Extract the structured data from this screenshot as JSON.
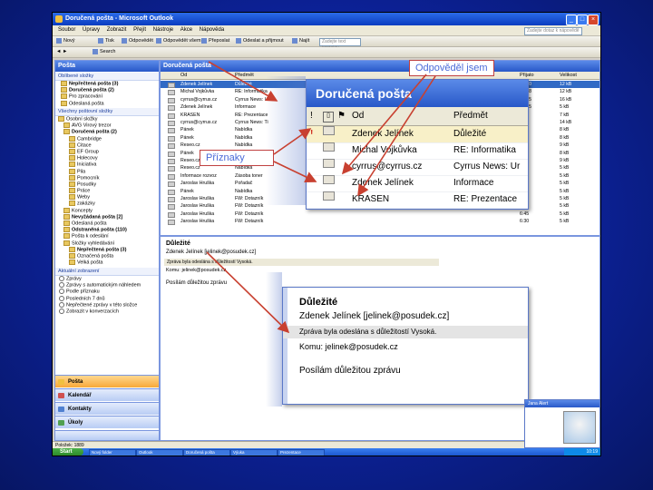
{
  "window": {
    "title": "Doručená pošta - Microsoft Outlook"
  },
  "menu": [
    "Soubor",
    "Úpravy",
    "Zobrazit",
    "Přejít",
    "Nástroje",
    "Akce",
    "Nápověda"
  ],
  "help_box": "Zadejte dotaz k nápovědě",
  "toolbar1": {
    "new": "Nový",
    "print": "Tisk",
    "reply": "Odpovědět",
    "reply_all": "Odpovědět všem",
    "forward": "Přeposlat",
    "send_receive": "Odeslat a přijmout",
    "find": "Najít",
    "search_placeholder": "Zadejte text kontaktu"
  },
  "toolbar2": {
    "search": "Search"
  },
  "nav": {
    "header": "Pošta",
    "favorites_title": "Oblíbené složky",
    "favorites": [
      {
        "label": "Nepřečtená pošta (3)",
        "bold": true
      },
      {
        "label": "Doručená pošta (2)",
        "bold": true
      },
      {
        "label": "Pro zpracování",
        "bold": false
      },
      {
        "label": "Odeslaná pošta",
        "bold": false
      }
    ],
    "allmail_title": "Všechny poštovní složky",
    "folders": [
      {
        "label": "Osobní složky",
        "indent": 0,
        "bold": false
      },
      {
        "label": "AVG Virový trezor",
        "indent": 1,
        "bold": false
      },
      {
        "label": "Doručená pošta (2)",
        "indent": 1,
        "bold": true
      },
      {
        "label": "Cambridge",
        "indent": 2,
        "bold": false
      },
      {
        "label": "Citace",
        "indent": 2,
        "bold": false
      },
      {
        "label": "EF Group",
        "indent": 2,
        "bold": false
      },
      {
        "label": "Holecovy",
        "indent": 2,
        "bold": false
      },
      {
        "label": "Iniciativa",
        "indent": 2,
        "bold": false
      },
      {
        "label": "Pila",
        "indent": 2,
        "bold": false
      },
      {
        "label": "Pomocník",
        "indent": 2,
        "bold": false
      },
      {
        "label": "Posudky",
        "indent": 2,
        "bold": false
      },
      {
        "label": "Práce",
        "indent": 2,
        "bold": false
      },
      {
        "label": "Weby",
        "indent": 2,
        "bold": false
      },
      {
        "label": "zakázky",
        "indent": 2,
        "bold": false
      },
      {
        "label": "Koncepty",
        "indent": 1,
        "bold": false
      },
      {
        "label": "Nevyžádaná pošta [2]",
        "indent": 1,
        "bold": true
      },
      {
        "label": "Odeslaná pošta",
        "indent": 1,
        "bold": false
      },
      {
        "label": "Odstraněná pošta (110)",
        "indent": 1,
        "bold": true
      },
      {
        "label": "Pošta k odeslání",
        "indent": 1,
        "bold": false
      },
      {
        "label": "Složky vyhledávání",
        "indent": 1,
        "bold": false
      },
      {
        "label": "Nepřečtená pošta (3)",
        "indent": 2,
        "bold": true
      },
      {
        "label": "Označená pošta",
        "indent": 2,
        "bold": false
      },
      {
        "label": "Velká pošta",
        "indent": 2,
        "bold": false
      }
    ],
    "current_view_title": "Aktuální zobrazení",
    "views": [
      "Zprávy",
      "Zprávy s automatickým náhledem",
      "Podle příznaku",
      "Posledních 7 dnů",
      "Nepřečtené zprávy v této složce",
      "Zobrazit v konverzacích"
    ],
    "buttons": [
      {
        "label": "Pošta",
        "active": true,
        "color": "#f0c040"
      },
      {
        "label": "Kalendář",
        "active": false,
        "color": "#d05050"
      },
      {
        "label": "Kontakty",
        "active": false,
        "color": "#5080d0"
      },
      {
        "label": "Úkoly",
        "active": false,
        "color": "#50a050"
      }
    ]
  },
  "list": {
    "header": "Doručená pošta",
    "columns": {
      "from": "Od",
      "subject": "Předmět",
      "received": "Přijato",
      "size": "Velikost"
    },
    "rows": [
      {
        "from": "Zdenek Jelínek",
        "subject": "Důležité",
        "received": "10:20",
        "size": "12 kB",
        "selected": true
      },
      {
        "from": "Michal Vojkůvka",
        "subject": "RE: Informatika",
        "received": "10:18",
        "size": "12 kB",
        "selected": false
      },
      {
        "from": "cyrrus@cyrrus.cz",
        "subject": "Cyrrus News: Um",
        "received": "10:15",
        "size": "16 kB",
        "selected": false
      },
      {
        "from": "Zdenek Jelínek",
        "subject": "Informace",
        "received": "10:05",
        "size": "5 kB",
        "selected": false
      },
      {
        "from": "KRASEN",
        "subject": "RE: Prezentace",
        "received": "9:58",
        "size": "7 kB",
        "selected": false
      },
      {
        "from": "cyrrus@cyrrus.cz",
        "subject": "Cyrrus News: Ti",
        "received": "9:40",
        "size": "14 kB",
        "selected": false
      },
      {
        "from": "Pánek",
        "subject": "Nabídka",
        "received": "9:12",
        "size": "8 kB",
        "selected": false
      },
      {
        "from": "Pánek",
        "subject": "Nabídka",
        "received": "9:10",
        "size": "8 kB",
        "selected": false
      },
      {
        "from": "Reseo.cz",
        "subject": "Nabídka",
        "received": "8:55",
        "size": "9 kB",
        "selected": false
      },
      {
        "from": "Pánek",
        "subject": "Nabídka",
        "received": "8:40",
        "size": "8 kB",
        "selected": false
      },
      {
        "from": "Reseo.cz",
        "subject": "Nabídka",
        "received": "8:30",
        "size": "9 kB",
        "selected": false
      },
      {
        "from": "Reseo.cz",
        "subject": "Nabídka",
        "received": "8:12",
        "size": "5 kB",
        "selected": false
      },
      {
        "from": "Informace rozvoz",
        "subject": "Zásoba toner",
        "received": "8:00",
        "size": "5 kB",
        "selected": false
      },
      {
        "from": "Jaroslav Hruška",
        "subject": "Pořadač",
        "received": "7:45",
        "size": "5 kB",
        "selected": false
      },
      {
        "from": "Pánek",
        "subject": "Nabídka",
        "received": "7:30",
        "size": "5 kB",
        "selected": false
      },
      {
        "from": "Jaroslav Hruška",
        "subject": "FW: Dotazník",
        "received": "7:12",
        "size": "5 kB",
        "selected": false
      },
      {
        "from": "Jaroslav Hruška",
        "subject": "FW: Dotazník",
        "received": "7:00",
        "size": "5 kB",
        "selected": false
      },
      {
        "from": "Jaroslav Hruška",
        "subject": "FW: Dotazník",
        "received": "6:45",
        "size": "5 kB",
        "selected": false
      },
      {
        "from": "Jaroslav Hruška",
        "subject": "FW: Dotazník",
        "received": "6:30",
        "size": "5 kB",
        "selected": false
      }
    ]
  },
  "preview": {
    "title": "Důležité",
    "from": "Zdenek Jelínek [jelinek@posudek.cz]",
    "info": "Zpráva byla odeslána s důležitostí Vysoká.",
    "to_label": "Komu:",
    "to": "jelinek@posudek.cz",
    "body": "Posílám důležitou zprávu"
  },
  "zoom_list": {
    "header": "Doručená pošta",
    "col_from": "Od",
    "col_subject": "Předmět",
    "rows": [
      {
        "from": "Zdenek Jelínek",
        "subject": "Důležité",
        "selected": true
      },
      {
        "from": "Michal Vojkůvka",
        "subject": "RE: Informatika",
        "selected": false
      },
      {
        "from": "cyrrus@cyrrus.cz",
        "subject": "Cyrrus News: Ur",
        "selected": false
      },
      {
        "from": "Zdenek Jelínek",
        "subject": "Informace",
        "selected": false
      },
      {
        "from": "KRASEN",
        "subject": "RE: Prezentace",
        "selected": false
      }
    ]
  },
  "zoom_preview": {
    "title": "Důležité",
    "from": "Zdenek Jelínek [jelinek@posudek.cz]",
    "info": "Zpráva byla odeslána s důležitostí Vysoká.",
    "to_label": "Komu:",
    "to": "jelinek@posudek.cz",
    "body": "Posílám důležitou zprávu"
  },
  "callouts": {
    "replied": "Odpověděl jsem",
    "flags": "Příznaky"
  },
  "status": "Položek: 1889",
  "taskbar": {
    "start": "Start",
    "tasks": [
      "Nový folder",
      "Outlook",
      "Doručená pošta",
      "Výuka",
      "Prezentace"
    ],
    "time": "10:19"
  },
  "msn": {
    "title": "Jana Alert"
  },
  "colors": {
    "accent": "#2858c8",
    "selected_row": "#316ac5",
    "callout_border": "#c04040",
    "callout_text": "#4a6ad8",
    "arrow": "#c84030",
    "flag_red": "#d03020"
  }
}
